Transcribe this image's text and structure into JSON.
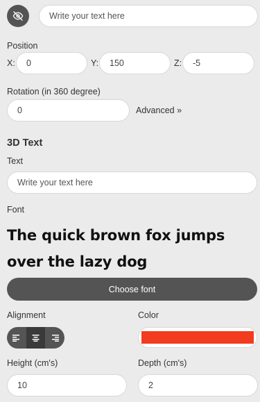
{
  "top": {
    "text_placeholder": "Write your text here",
    "visibility_icon": "eye-off-icon"
  },
  "position": {
    "label": "Position",
    "x_label": "X:",
    "y_label": "Y:",
    "z_label": "Z:",
    "x_value": "0",
    "y_value": "150",
    "z_value": "-5"
  },
  "rotation": {
    "label": "Rotation (in 360 degree)",
    "value": "0",
    "advanced_link": "Advanced »"
  },
  "text3d": {
    "title": "3D Text",
    "text_label": "Text",
    "text_placeholder": "Write your text here",
    "font_label": "Font",
    "font_sample": "The quick brown fox jumps over the lazy dog",
    "choose_font_button": "Choose font"
  },
  "alignment": {
    "label": "Alignment",
    "buttons": [
      {
        "icon": "align-left-icon"
      },
      {
        "icon": "align-center-icon",
        "active": true
      },
      {
        "icon": "align-right-icon"
      }
    ]
  },
  "color": {
    "label": "Color",
    "value": "#f23b1f"
  },
  "height": {
    "label": "Height (cm's)",
    "value": "10"
  },
  "depth": {
    "label": "Depth (cm's)",
    "value": "2"
  }
}
